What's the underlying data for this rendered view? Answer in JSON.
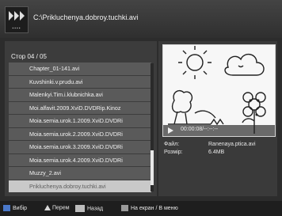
{
  "header": {
    "path": "C:\\Prikluchenya.dobroy.tuchki.avi"
  },
  "list": {
    "page_info": "Стор 04 / 05",
    "items": [
      "Chapter_01-141.avi",
      "Kuvshinki.v.prudu.avi",
      "Malenkyi.Tim.i.klubnichka.avi",
      "Moi.alfavit.2009.XviD.DVDRip.Kinoz",
      "Moia.semia.urok.1.2009.XviD.DVDRi",
      "Moia.semia.urok.2.2009.XviD.DVDRi",
      "Moia.semia.urok.3.2009.XviD.DVDRi",
      "Moia.semia.urok.4.2009.XviD.DVDRi",
      "Muzzy_2.avi",
      "Prikluchenya.dobroy.tuchki.avi"
    ],
    "selected_index": 9
  },
  "preview": {
    "timecode": "00:00:08/--:--:--"
  },
  "file_info": {
    "file_label": "Файл:",
    "file_value": "Ranenaya.ptica.avi",
    "size_label": "Розмір:",
    "size_value": "6.4MB"
  },
  "footer": {
    "select_label": "Вибір",
    "move_label": "Перем",
    "back_label": "Назад",
    "fullscreen_label": "На екран / В меню"
  },
  "colors": {
    "row_bg": "#5a5a5a",
    "row_selected_bg": "#c9c9c9",
    "key_blue": "#4a78c9"
  }
}
